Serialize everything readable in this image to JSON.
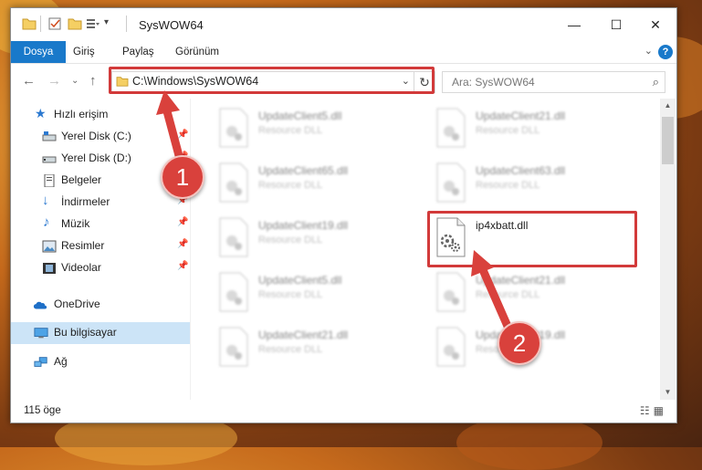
{
  "window": {
    "title": "SysWOW64",
    "controls": {
      "minimize": "—",
      "maximize": "☐",
      "close": "✕"
    }
  },
  "ribbon": {
    "tabs": [
      {
        "label": "Dosya",
        "active": true
      },
      {
        "label": "Giriş",
        "active": false
      },
      {
        "label": "Paylaş",
        "active": false
      },
      {
        "label": "Görünüm",
        "active": false
      }
    ],
    "help_label": "?"
  },
  "navigation": {
    "address": "C:\\Windows\\SysWOW64",
    "search_placeholder": "Ara: SysWOW64"
  },
  "sidebar": {
    "items": [
      {
        "label": "Hızlı erişim",
        "icon": "star-icon",
        "pinned": false
      },
      {
        "label": "Yerel Disk (C:)",
        "icon": "drive-icon",
        "pinned": true
      },
      {
        "label": "Yerel Disk (D:)",
        "icon": "drive-icon",
        "pinned": true
      },
      {
        "label": "Belgeler",
        "icon": "documents-icon",
        "pinned": true
      },
      {
        "label": "İndirmeler",
        "icon": "download-icon",
        "pinned": true
      },
      {
        "label": "Müzik",
        "icon": "music-icon",
        "pinned": true
      },
      {
        "label": "Resimler",
        "icon": "pictures-icon",
        "pinned": true
      },
      {
        "label": "Videolar",
        "icon": "videos-icon",
        "pinned": true
      },
      {
        "label": "OneDrive",
        "icon": "cloud-icon",
        "pinned": false
      },
      {
        "label": "Bu bilgisayar",
        "icon": "computer-icon",
        "pinned": false,
        "selected": true
      },
      {
        "label": "Ağ",
        "icon": "network-icon",
        "pinned": false
      }
    ]
  },
  "files": [
    {
      "name": "UpdateClient5.dll",
      "type": "Resource DLL",
      "blurred": true
    },
    {
      "name": "UpdateClient21.dll",
      "type": "Resource DLL",
      "blurred": true
    },
    {
      "name": "UpdateClient65.dll",
      "type": "Resource DLL",
      "blurred": true
    },
    {
      "name": "UpdateClient63.dll",
      "type": "Resource DLL",
      "blurred": true
    },
    {
      "name": "UpdateClient19.dll",
      "type": "Resource DLL",
      "blurred": true
    },
    {
      "name": "ip4xbatt.dll",
      "type": "",
      "blurred": false
    },
    {
      "name": "UpdateClient5.dll",
      "type": "Resource DLL",
      "blurred": true
    },
    {
      "name": "UpdateClient21.dll",
      "type": "Resource DLL",
      "blurred": true
    },
    {
      "name": "UpdateClient21.dll",
      "type": "Resource DLL",
      "blurred": true
    },
    {
      "name": "UpdateClient19.dll",
      "type": "Resource DLL",
      "blurred": true
    }
  ],
  "status": {
    "item_count": "115 öge"
  },
  "callouts": [
    "1",
    "2"
  ],
  "colors": {
    "accent": "#1979ca",
    "highlight": "#d23a3a",
    "badge": "#d9413c",
    "selected": "#cce4f7"
  }
}
